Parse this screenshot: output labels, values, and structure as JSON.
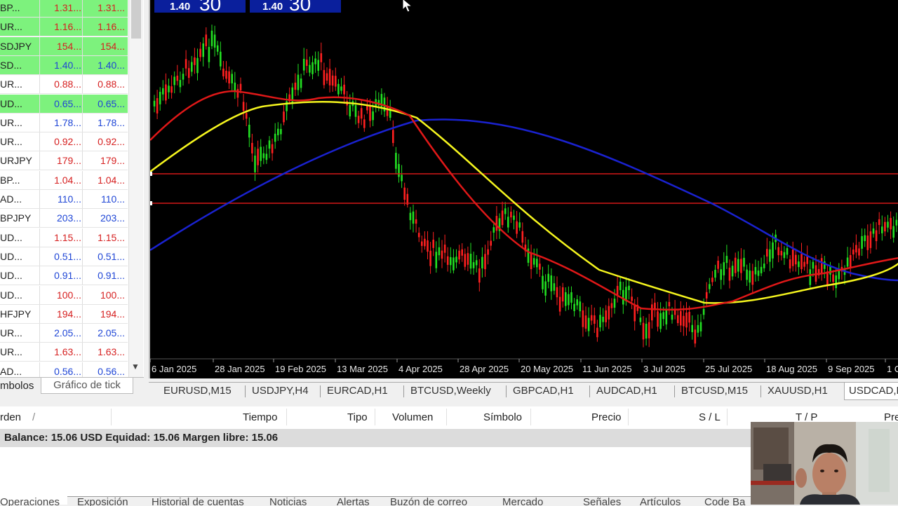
{
  "watch": {
    "rows": [
      {
        "sym": "BP...",
        "bid": "1.31...",
        "ask": "1.31...",
        "bg": "#7df27d",
        "bidColor": "#d61f1f",
        "askColor": "#d61f1f"
      },
      {
        "sym": "UR...",
        "bid": "1.16...",
        "ask": "1.16...",
        "bg": "#7df27d",
        "bidColor": "#d61f1f",
        "askColor": "#d61f1f"
      },
      {
        "sym": "SDJPY",
        "bid": "154...",
        "ask": "154...",
        "bg": "#7df27d",
        "bidColor": "#d61f1f",
        "askColor": "#d61f1f"
      },
      {
        "sym": "SD...",
        "bid": "1.40...",
        "ask": "1.40...",
        "bg": "#7df27d",
        "bidColor": "#1f46d6",
        "askColor": "#1f46d6"
      },
      {
        "sym": "UR...",
        "bid": "0.88...",
        "ask": "0.88...",
        "bg": "#ffffff",
        "bidColor": "#d61f1f",
        "askColor": "#d61f1f"
      },
      {
        "sym": "UD...",
        "bid": "0.65...",
        "ask": "0.65...",
        "bg": "#7df27d",
        "bidColor": "#1f46d6",
        "askColor": "#1f46d6"
      },
      {
        "sym": "UR...",
        "bid": "1.78...",
        "ask": "1.78...",
        "bg": "#ffffff",
        "bidColor": "#1f46d6",
        "askColor": "#1f46d6"
      },
      {
        "sym": "UR...",
        "bid": "0.92...",
        "ask": "0.92...",
        "bg": "#ffffff",
        "bidColor": "#d61f1f",
        "askColor": "#d61f1f"
      },
      {
        "sym": "URJPY",
        "bid": "179...",
        "ask": "179...",
        "bg": "#ffffff",
        "bidColor": "#d61f1f",
        "askColor": "#d61f1f"
      },
      {
        "sym": "BP...",
        "bid": "1.04...",
        "ask": "1.04...",
        "bg": "#ffffff",
        "bidColor": "#d61f1f",
        "askColor": "#d61f1f"
      },
      {
        "sym": "AD...",
        "bid": "110...",
        "ask": "110...",
        "bg": "#ffffff",
        "bidColor": "#1f46d6",
        "askColor": "#1f46d6"
      },
      {
        "sym": "BPJPY",
        "bid": "203...",
        "ask": "203...",
        "bg": "#ffffff",
        "bidColor": "#1f46d6",
        "askColor": "#1f46d6"
      },
      {
        "sym": "UD...",
        "bid": "1.15...",
        "ask": "1.15...",
        "bg": "#ffffff",
        "bidColor": "#d61f1f",
        "askColor": "#d61f1f"
      },
      {
        "sym": "UD...",
        "bid": "0.51...",
        "ask": "0.51...",
        "bg": "#ffffff",
        "bidColor": "#1f46d6",
        "askColor": "#1f46d6"
      },
      {
        "sym": "UD...",
        "bid": "0.91...",
        "ask": "0.91...",
        "bg": "#ffffff",
        "bidColor": "#1f46d6",
        "askColor": "#1f46d6"
      },
      {
        "sym": "UD...",
        "bid": "100...",
        "ask": "100...",
        "bg": "#ffffff",
        "bidColor": "#d61f1f",
        "askColor": "#d61f1f"
      },
      {
        "sym": "HFJPY",
        "bid": "194...",
        "ask": "194...",
        "bg": "#ffffff",
        "bidColor": "#d61f1f",
        "askColor": "#d61f1f"
      },
      {
        "sym": "UR...",
        "bid": "2.05...",
        "ask": "2.05...",
        "bg": "#ffffff",
        "bidColor": "#1f46d6",
        "askColor": "#1f46d6"
      },
      {
        "sym": "UR...",
        "bid": "1.63...",
        "ask": "1.63...",
        "bg": "#ffffff",
        "bidColor": "#d61f1f",
        "askColor": "#d61f1f"
      },
      {
        "sym": "AD...",
        "bid": "0.56...",
        "ask": "0.56...",
        "bg": "#ffffff",
        "bidColor": "#1f46d6",
        "askColor": "#1f46d6"
      }
    ],
    "tab_symbols": "mbolos",
    "tab_tick": "Gráfico de tick"
  },
  "chart": {
    "price_tags": [
      {
        "small": "1.40",
        "big": "30"
      },
      {
        "small": "1.40",
        "big": "30"
      }
    ],
    "date_labels": [
      "6 Jan 2025",
      "28 Jan 2025",
      "19 Feb 2025",
      "13 Mar 2025",
      "4 Apr 2025",
      "28 Apr 2025",
      "20 May 2025",
      "11 Jun 2025",
      "3 Jul 2025",
      "25 Jul 2025",
      "18 Aug 2025",
      "9 Sep 2025",
      "1 O"
    ],
    "colors": {
      "bull": "#22e022",
      "bear": "#ff2020",
      "ma_fast": "#e01818",
      "ma_mid": "#f5f51e",
      "ma_slow": "#1a22d0",
      "hline": "#d41818",
      "background": "#000000"
    }
  },
  "chart_tabs": [
    "EURUSD,M15",
    "USDJPY,H4",
    "EURCAD,H1",
    "BTCUSD,Weekly",
    "GBPCAD,H1",
    "AUDCAD,H1",
    "BTCUSD,M15",
    "XAUUSD,H1",
    "USDCAD,D"
  ],
  "chart_tabs_active": 8,
  "terminal": {
    "headers": [
      "rden",
      "/",
      "Tiempo",
      "Tipo",
      "Volumen",
      "Símbolo",
      "Precio",
      "S / L",
      "T / P",
      "Pre"
    ],
    "balance": "Balance: 15.06 USD  Equidad: 15.06  Margen libre: 15.06",
    "bottom_tabs": [
      "Operaciones",
      "Exposición",
      "Historial de cuentas",
      "Noticias",
      "Alertas",
      "Buzón de correo",
      "Mercado",
      "Señales",
      "Artículos",
      "Code Ba"
    ]
  }
}
